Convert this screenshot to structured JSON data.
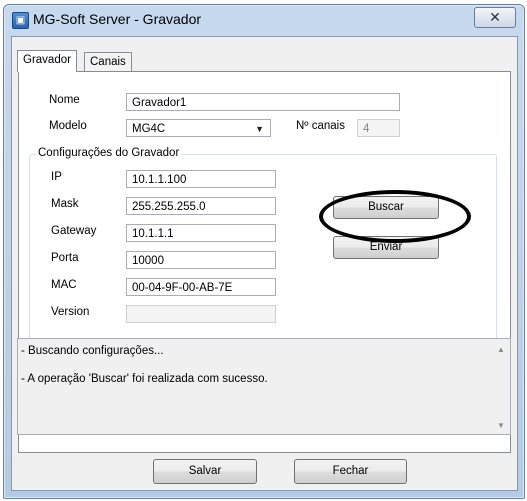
{
  "window": {
    "title": "MG-Soft Server - Gravador",
    "close_glyph": "✕",
    "app_icon": "app-icon"
  },
  "tabs": [
    {
      "label": "Gravador",
      "active": true
    },
    {
      "label": "Canais",
      "active": false
    }
  ],
  "form": {
    "nome_label": "Nome",
    "nome_value": "Gravador1",
    "modelo_label": "Modelo",
    "modelo_value": "MG4C",
    "ncanais_label": "Nº canais",
    "ncanais_value": "4"
  },
  "config": {
    "title": "Configurações do Gravador",
    "ip_label": "IP",
    "ip_value": "10.1.1.100",
    "mask_label": "Mask",
    "mask_value": "255.255.255.0",
    "gateway_label": "Gateway",
    "gateway_value": "10.1.1.1",
    "porta_label": "Porta",
    "porta_value": "10000",
    "mac_label": "MAC",
    "mac_value": "00-04-9F-00-AB-7E",
    "version_label": "Version",
    "version_value": ""
  },
  "buttons": {
    "buscar": "Buscar",
    "enviar": "Enviar",
    "salvar": "Salvar",
    "fechar": "Fechar"
  },
  "log": {
    "lines": [
      "- Buscando configurações...",
      "- A operação 'Buscar' foi realizada com sucesso."
    ]
  },
  "colors": {
    "titlebar": "#b9cfe9",
    "annotation": "#000000"
  }
}
